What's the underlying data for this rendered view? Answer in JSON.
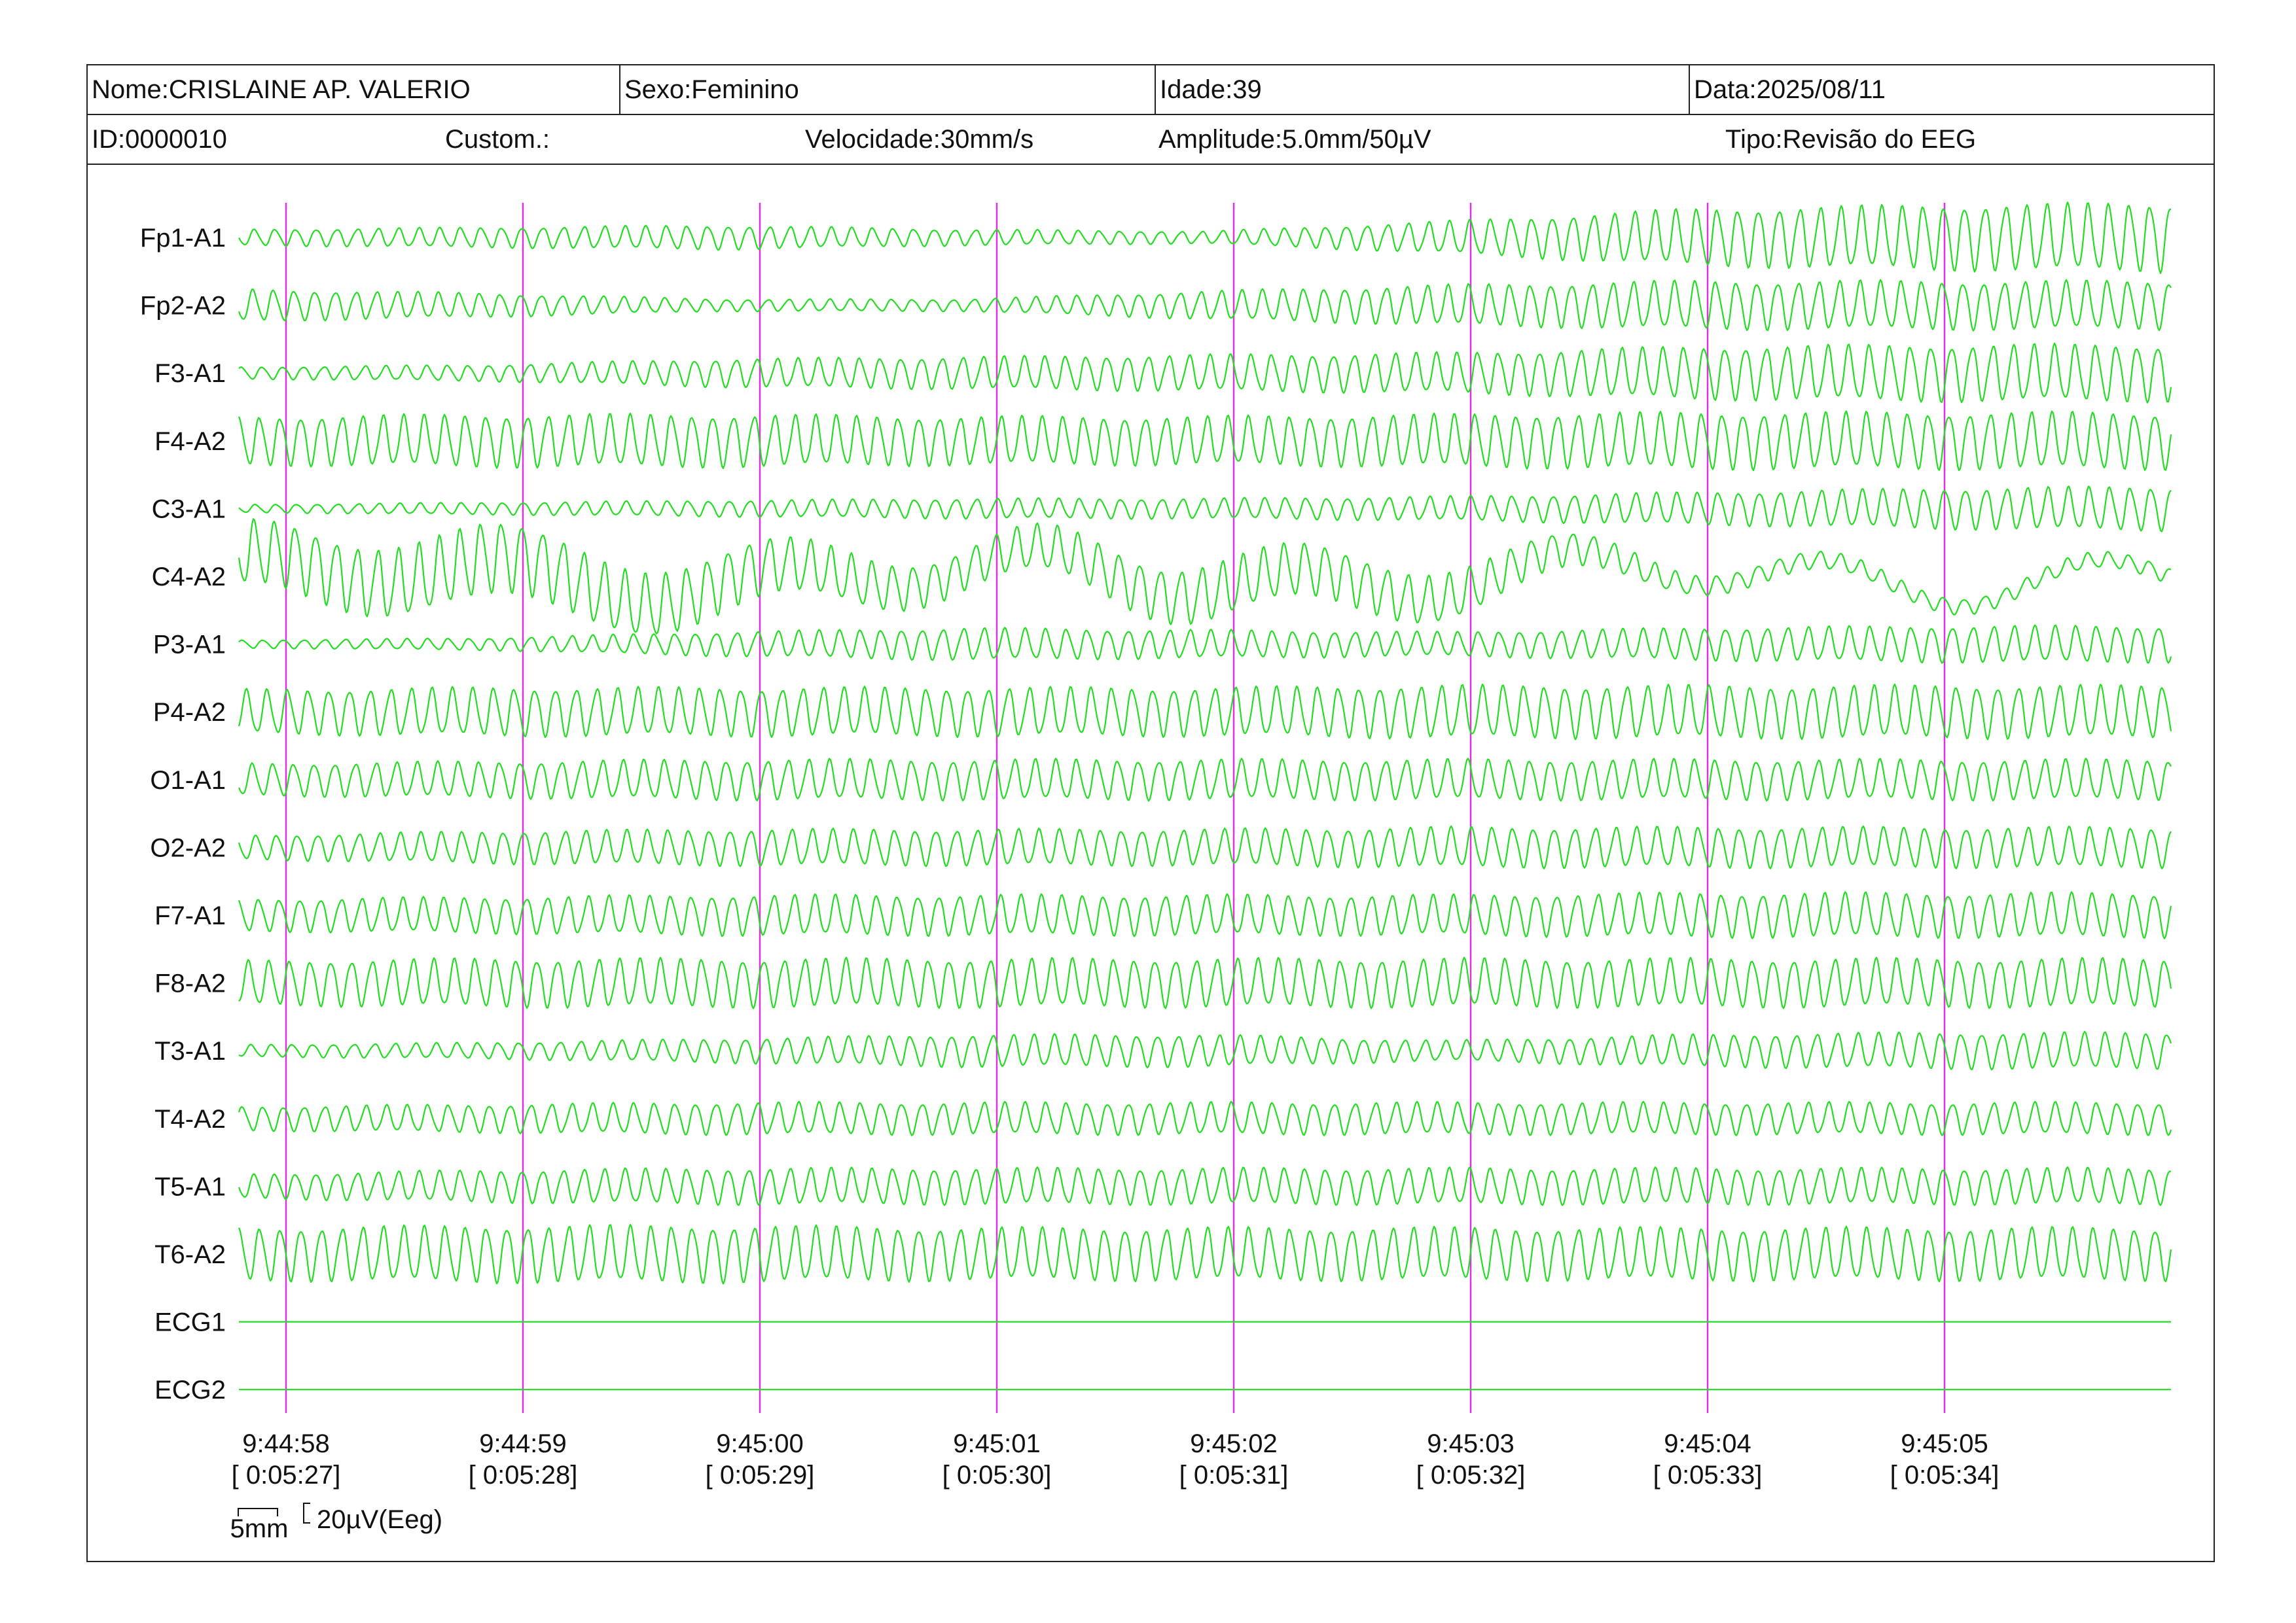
{
  "header": {
    "nome": "Nome:CRISLAINE AP. VALERIO",
    "sexo": "Sexo:Feminino",
    "idade": "Idade:39",
    "data": "Data:2025/08/11",
    "id": "ID:0000010",
    "custom": "Custom.:",
    "velocidade": "Velocidade:30mm/s",
    "amplitude": "Amplitude:5.0mm/50µV",
    "tipo": "Tipo:Revisão do EEG"
  },
  "colors": {
    "trace": "#22dd22",
    "marker": "#dd33dd",
    "text": "#111111"
  },
  "chart_data": {
    "type": "line",
    "title": "",
    "xlabel": "",
    "ylabel": "",
    "xlim": [
      "9:44:57.8",
      "9:45:06.0"
    ],
    "time_ticks": [
      {
        "time": "9:44:58",
        "elapsed": "[ 0:05:27]"
      },
      {
        "time": "9:44:59",
        "elapsed": "[ 0:05:28]"
      },
      {
        "time": "9:45:00",
        "elapsed": "[ 0:05:29]"
      },
      {
        "time": "9:45:01",
        "elapsed": "[ 0:05:30]"
      },
      {
        "time": "9:45:02",
        "elapsed": "[ 0:05:31]"
      },
      {
        "time": "9:45:03",
        "elapsed": "[ 0:05:32]"
      },
      {
        "time": "9:45:04",
        "elapsed": "[ 0:05:33]"
      },
      {
        "time": "9:45:05",
        "elapsed": "[ 0:05:34]"
      }
    ],
    "series": [
      {
        "name": "Fp1-A1",
        "freq_hz": 11.5,
        "amp_profile_uv": [
          4,
          5,
          6,
          4,
          3,
          8,
          14,
          16,
          17
        ]
      },
      {
        "name": "Fp2-A2",
        "freq_hz": 11.5,
        "amp_profile_uv": [
          8,
          6,
          3,
          3,
          7,
          10,
          12,
          12,
          12
        ]
      },
      {
        "name": "F3-A1",
        "freq_hz": 11.5,
        "amp_profile_uv": [
          3,
          4,
          7,
          8,
          9,
          10,
          13,
          14,
          14
        ]
      },
      {
        "name": "F4-A2",
        "freq_hz": 11.5,
        "amp_profile_uv": [
          12,
          13,
          13,
          12,
          12,
          13,
          14,
          14,
          14
        ]
      },
      {
        "name": "C3-A1",
        "freq_hz": 11.5,
        "amp_profile_uv": [
          2,
          3,
          4,
          5,
          5,
          6,
          8,
          10,
          11
        ]
      },
      {
        "name": "C4-A2",
        "freq_hz": 11.5,
        "amp_profile_uv": [
          16,
          18,
          15,
          10,
          14,
          12,
          5,
          4,
          4
        ],
        "slow_wave_uv": 10
      },
      {
        "name": "P3-A1",
        "freq_hz": 11.5,
        "amp_profile_uv": [
          2,
          3,
          6,
          8,
          7,
          6,
          8,
          9,
          9
        ]
      },
      {
        "name": "P4-A2",
        "freq_hz": 11.5,
        "amp_profile_uv": [
          11,
          12,
          12,
          12,
          12,
          13,
          13,
          13,
          13
        ]
      },
      {
        "name": "O1-A1",
        "freq_hz": 11.5,
        "amp_profile_uv": [
          8,
          9,
          10,
          10,
          10,
          10,
          10,
          10,
          10
        ]
      },
      {
        "name": "O2-A2",
        "freq_hz": 11.5,
        "amp_profile_uv": [
          6,
          8,
          9,
          9,
          9,
          10,
          10,
          10,
          10
        ]
      },
      {
        "name": "F7-A1",
        "freq_hz": 11.5,
        "amp_profile_uv": [
          8,
          9,
          10,
          10,
          10,
          10,
          11,
          11,
          11
        ]
      },
      {
        "name": "F8-A2",
        "freq_hz": 11.5,
        "amp_profile_uv": [
          11,
          12,
          12,
          12,
          12,
          12,
          12,
          12,
          12
        ]
      },
      {
        "name": "T3-A1",
        "freq_hz": 11.5,
        "amp_profile_uv": [
          3,
          4,
          6,
          8,
          8,
          5,
          8,
          9,
          9
        ]
      },
      {
        "name": "T4-A2",
        "freq_hz": 11.5,
        "amp_profile_uv": [
          6,
          7,
          8,
          8,
          8,
          8,
          8,
          8,
          8
        ]
      },
      {
        "name": "T5-A1",
        "freq_hz": 11.5,
        "amp_profile_uv": [
          6,
          8,
          9,
          9,
          9,
          9,
          9,
          9,
          9
        ]
      },
      {
        "name": "T6-A2",
        "freq_hz": 11.5,
        "amp_profile_uv": [
          13,
          14,
          14,
          13,
          13,
          13,
          13,
          13,
          13
        ]
      },
      {
        "name": "ECG1",
        "freq_hz": 0,
        "amp_profile_uv": [
          0,
          0,
          0,
          0,
          0,
          0,
          0,
          0,
          0
        ]
      },
      {
        "name": "ECG2",
        "freq_hz": 0,
        "amp_profile_uv": [
          0,
          0,
          0,
          0,
          0,
          0,
          0,
          0,
          0
        ]
      }
    ],
    "scale_bar": {
      "time_label": "5mm",
      "amplitude_label": "20µV(Eeg)"
    },
    "grid": false,
    "legend": "none"
  }
}
